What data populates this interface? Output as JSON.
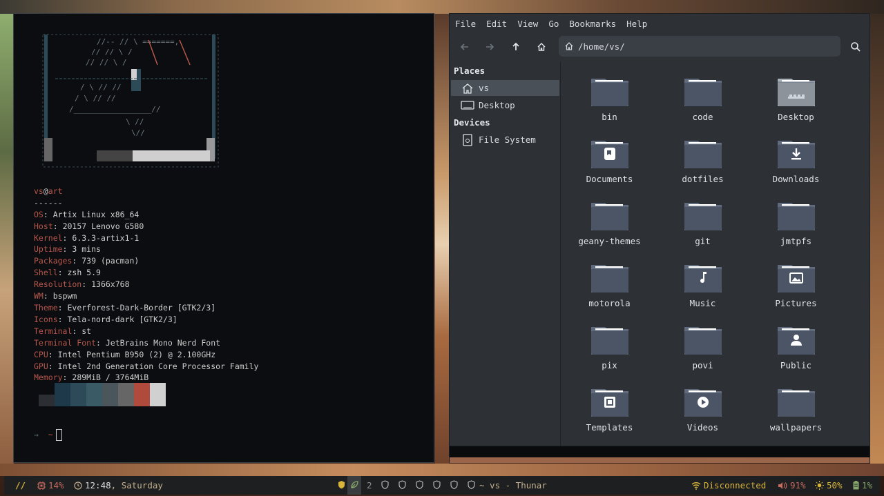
{
  "terminal": {
    "fetch_user": "vs",
    "fetch_host": "art",
    "fetch_sep": "------",
    "info": [
      {
        "key": "OS",
        "value": "Artix Linux x86_64"
      },
      {
        "key": "Host",
        "value": "20157 Lenovo G580"
      },
      {
        "key": "Kernel",
        "value": "6.3.3-artix1-1"
      },
      {
        "key": "Uptime",
        "value": "3 mins"
      },
      {
        "key": "Packages",
        "value": "739 (pacman)"
      },
      {
        "key": "Shell",
        "value": "zsh 5.9"
      },
      {
        "key": "Resolution",
        "value": "1366x768"
      },
      {
        "key": "WM",
        "value": "bspwm"
      },
      {
        "key": "Theme",
        "value": "Everforest-Dark-Border [GTK2/3]"
      },
      {
        "key": "Icons",
        "value": "Tela-nord-dark [GTK2/3]"
      },
      {
        "key": "Terminal",
        "value": "st"
      },
      {
        "key": "Terminal Font",
        "value": "JetBrains Mono Nerd Font"
      },
      {
        "key": "CPU",
        "value": "Intel Pentium B950 (2) @ 2.100GHz"
      },
      {
        "key": "GPU",
        "value": "Intel 2nd Generation Core Processor Family"
      },
      {
        "key": "Memory",
        "value": "289MiB / 3764MiB"
      }
    ],
    "palette": [
      "#2b2f33",
      "#1e3a4a",
      "#2c4a58",
      "#3a5a66",
      "#4a555c",
      "#666666",
      "#b04a3c",
      "#d0d0d0"
    ],
    "prompt_arrow": "→",
    "prompt_dir": "~"
  },
  "thunar": {
    "menu": [
      "File",
      "Edit",
      "View",
      "Go",
      "Bookmarks",
      "Help"
    ],
    "location": "/home/vs/",
    "places_label": "Places",
    "devices_label": "Devices",
    "places": [
      {
        "label": "vs",
        "icon": "home-icon",
        "active": true
      },
      {
        "label": "Desktop",
        "icon": "desktop-icon",
        "active": false
      }
    ],
    "devices": [
      {
        "label": "File System",
        "icon": "drive-icon",
        "active": false
      }
    ],
    "files": [
      {
        "name": "bin",
        "emblem": ""
      },
      {
        "name": "code",
        "emblem": ""
      },
      {
        "name": "Desktop",
        "emblem": "desktop"
      },
      {
        "name": "Documents",
        "emblem": "doc"
      },
      {
        "name": "dotfiles",
        "emblem": ""
      },
      {
        "name": "Downloads",
        "emblem": "download"
      },
      {
        "name": "geany-themes",
        "emblem": ""
      },
      {
        "name": "git",
        "emblem": ""
      },
      {
        "name": "jmtpfs",
        "emblem": ""
      },
      {
        "name": "motorola",
        "emblem": ""
      },
      {
        "name": "Music",
        "emblem": "music"
      },
      {
        "name": "Pictures",
        "emblem": "picture"
      },
      {
        "name": "pix",
        "emblem": ""
      },
      {
        "name": "povi",
        "emblem": ""
      },
      {
        "name": "Public",
        "emblem": "user"
      },
      {
        "name": "Templates",
        "emblem": "template"
      },
      {
        "name": "Videos",
        "emblem": "video"
      },
      {
        "name": "wallpapers",
        "emblem": ""
      }
    ]
  },
  "bar": {
    "logo": "//",
    "cpu": "14%",
    "time": "12:48",
    "day": ", Saturday",
    "workspace_num": "2",
    "window_title": "~ vs - Thunar",
    "network": "Disconnected",
    "volume": "91%",
    "brightness": "50%",
    "battery": "1%"
  },
  "colors": {
    "accent_red": "#b8574b",
    "bar_text": "#c3b08f",
    "bar_yellow": "#d8b43a",
    "folder": "#4b5566"
  }
}
